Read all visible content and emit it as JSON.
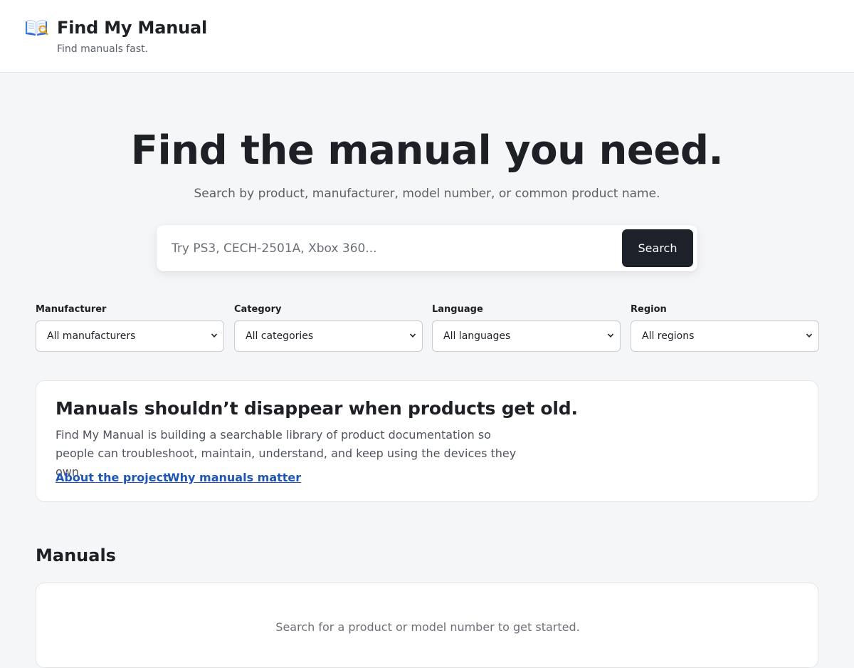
{
  "header": {
    "site_title": "Find My Manual",
    "tagline": "Find manuals fast.",
    "logo_icon": "open-book-icon"
  },
  "hero": {
    "title": "Find the manual you need.",
    "subtitle": "Search by product, manufacturer, model number, or common product name."
  },
  "search": {
    "placeholder": "Try PS3, CECH-2501A, Xbox 360...",
    "value": "",
    "button_label": "Search"
  },
  "filters": [
    {
      "label": "Manufacturer",
      "selected": "All manufacturers"
    },
    {
      "label": "Category",
      "selected": "All categories"
    },
    {
      "label": "Language",
      "selected": "All languages"
    },
    {
      "label": "Region",
      "selected": "All regions"
    }
  ],
  "info": {
    "title": "Manuals shouldn’t disappear when products get old.",
    "body": "Find My Manual is building a searchable library of product documentation so people can troubleshoot, maintain, understand, and keep using the devices they own.",
    "links": [
      "About the project",
      "Why manuals matter"
    ]
  },
  "manuals": {
    "heading": "Manuals",
    "empty_message": "Search for a product or model number to get started."
  },
  "colors": {
    "background": "#f5f6f8",
    "primary_button": "#1d2129",
    "link": "#1f56b5",
    "text": "#1d2025",
    "muted_text": "#5b6068"
  }
}
